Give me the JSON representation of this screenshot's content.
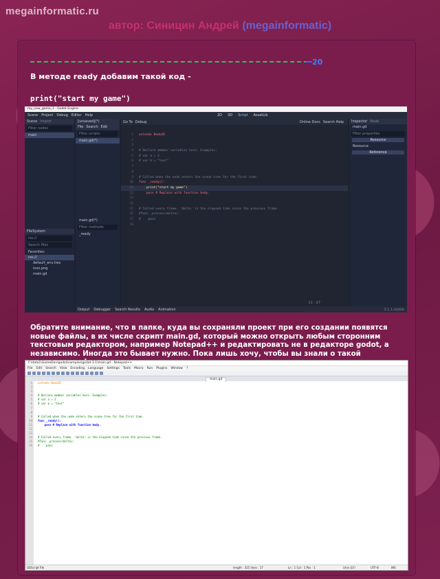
{
  "header": {
    "site": "megainformatic.ru",
    "author_prefix": "автор: Синицин Андрей ",
    "author_handle": "(megainformatic)"
  },
  "page_number": "20",
  "text1": "В методе ready добавим такой код -",
  "code_snippet": "print(\"start my game\")",
  "paragraph": "Обратите внимание, что в папке, куда вы сохраняли проект при его создании появятся новые файлы, в их числе скрипт main.gd, который можно открыть любым сторонним текстовым редактором, например Notepad++ и редактировать не в редакторе godot, а независимо. Иногда это бывает нужно. Пока лишь хочу, чтобы вы знали о такой возможности!",
  "godot": {
    "title": "my_new_game_1 - Godot Engine",
    "menu": [
      "Scene",
      "Project",
      "Debug",
      "Editor",
      "Help"
    ],
    "workspaces": [
      "2D",
      "3D",
      "Script",
      "AssetLib"
    ],
    "scene_dock": {
      "tabs": [
        "Scene",
        "Import"
      ],
      "filter": "Filter nodes",
      "node": "main"
    },
    "filesystem": {
      "tab": "FileSystem",
      "path": "res://",
      "search": "Search files",
      "items": [
        "Favorites:",
        "res://",
        "default_env.tres",
        "icon.png",
        "main.gd"
      ]
    },
    "script_menu": [
      "File",
      "Search",
      "Edit",
      "Go To",
      "Debug"
    ],
    "editor_tab": "[unsaved](*)",
    "online_docs": "Online Docs",
    "search_help": "Search Help",
    "scripts_filter": "Filter scripts",
    "script_item": "main.gd(*)",
    "methods_label": "main.gd(*)",
    "methods_filter": "Filter methods",
    "method_item": "_ready",
    "lines": [
      {
        "n": "1",
        "t": "extends Node2D",
        "c": "kw"
      },
      {
        "n": "2",
        "t": "",
        "c": ""
      },
      {
        "n": "3",
        "t": "",
        "c": ""
      },
      {
        "n": "4",
        "t": "# Declare member variables here. Examples:",
        "c": "cm"
      },
      {
        "n": "5",
        "t": "# var a = 2",
        "c": "cm"
      },
      {
        "n": "6",
        "t": "# var b = \"text\"",
        "c": "cm"
      },
      {
        "n": "7",
        "t": "",
        "c": ""
      },
      {
        "n": "8",
        "t": "",
        "c": ""
      },
      {
        "n": "9",
        "t": "# Called when the node enters the scene tree for the first time.",
        "c": "cm"
      },
      {
        "n": "10",
        "t": "func _ready():",
        "c": "kw"
      },
      {
        "n": "11",
        "t": "    print(\"start my game\")",
        "c": "st"
      },
      {
        "n": "12",
        "t": "    pass # Replace with function body.",
        "c": "kw"
      },
      {
        "n": "13",
        "t": "",
        "c": ""
      },
      {
        "n": "14",
        "t": "",
        "c": ""
      },
      {
        "n": "15",
        "t": "# Called every frame. 'delta' is the elapsed time since the previous frame.",
        "c": "cm"
      },
      {
        "n": "16",
        "t": "#func _process(delta):",
        "c": "cm"
      },
      {
        "n": "17",
        "t": "#    pass",
        "c": "cm"
      },
      {
        "n": "18",
        "t": "",
        "c": ""
      }
    ],
    "inspector": {
      "tabs": [
        "Inspector",
        "Node"
      ],
      "file": "main.gd",
      "filter": "Filter properties",
      "btn1": "Resource",
      "section": "Resource",
      "btn2": "Reference"
    },
    "bottom_tabs": [
      "Output",
      "Debugger",
      "Search Results",
      "Audio",
      "Animation"
    ],
    "cursor_pos": "11 : 27",
    "version": "3.1.1.stable"
  },
  "npp": {
    "title": "F:\\data1\\GameDev\\godot\\samples\\godot-3.1\\main.gd - Notepad++",
    "menu": [
      "File",
      "Edit",
      "Search",
      "View",
      "Encoding",
      "Language",
      "Settings",
      "Tools",
      "Macro",
      "Run",
      "Plugins",
      "Window",
      "?"
    ],
    "tab": "main.gd",
    "lines": [
      {
        "n": "1",
        "t": "extends Node2D",
        "c": "ty"
      },
      {
        "n": "2",
        "t": "",
        "c": ""
      },
      {
        "n": "3",
        "t": "",
        "c": ""
      },
      {
        "n": "4",
        "t": "# Declare member variables here. Examples:",
        "c": "cm"
      },
      {
        "n": "5",
        "t": "# var a = 2",
        "c": "cm"
      },
      {
        "n": "6",
        "t": "# var b = \"text\"",
        "c": "cm"
      },
      {
        "n": "7",
        "t": "",
        "c": ""
      },
      {
        "n": "8",
        "t": "",
        "c": ""
      },
      {
        "n": "9",
        "t": "# Called when the node enters the scene tree for the first time.",
        "c": "cm"
      },
      {
        "n": "10",
        "t": "func _ready():",
        "c": "kw"
      },
      {
        "n": "11",
        "t": "    pass # Replace with function body.",
        "c": "kw"
      },
      {
        "n": "12",
        "t": "",
        "c": ""
      },
      {
        "n": "13",
        "t": "",
        "c": ""
      },
      {
        "n": "14",
        "t": "# Called every frame. 'delta' is the elapsed time since the previous frame.",
        "c": "cm"
      },
      {
        "n": "15",
        "t": "#func _process(delta):",
        "c": "cm"
      },
      {
        "n": "16",
        "t": "#    pass",
        "c": "cm"
      }
    ],
    "status": [
      "GDScript file",
      "length : 315    lines : 17",
      "Ln : 1    Col : 1    Pos : 1",
      "Unix (LF)",
      "UTF-8",
      "INS"
    ]
  },
  "colors": {
    "accent_green": "#30c060",
    "accent_blue": "#3a66ff",
    "author_red": "#c43070",
    "author_handle": "#6a5fd0"
  }
}
